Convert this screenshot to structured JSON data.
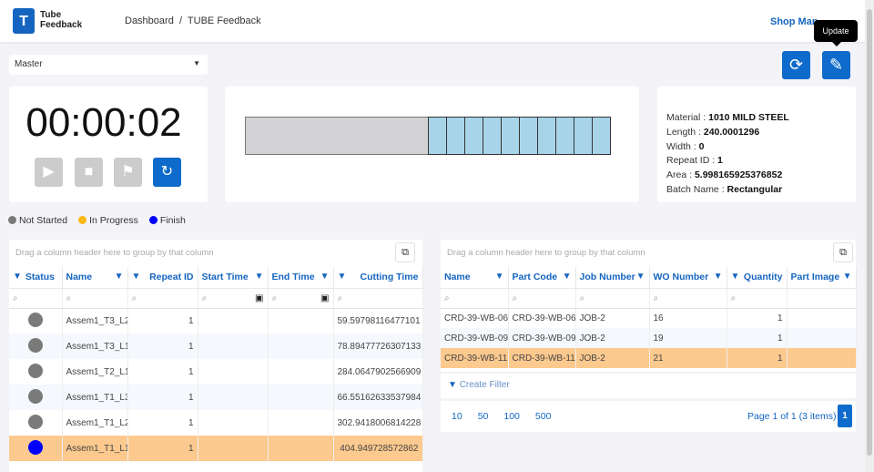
{
  "header": {
    "logo_line1": "Tube",
    "logo_line2": "Feedback",
    "breadcrumb": [
      "Dashboard",
      "TUBE Feedback"
    ],
    "user": "Shop Man"
  },
  "toolbar": {
    "select_value": "Master",
    "refresh_icon": "sync-icon",
    "update_icon": "edit-icon",
    "tooltip": "Update"
  },
  "timer": {
    "value": "00:00:02",
    "buttons": [
      "play-icon",
      "stop-icon",
      "flag-icon",
      "reset-icon"
    ]
  },
  "tube": {
    "total_segments": 10,
    "completed_color": "#d3d2d4",
    "segment_color": "#a8d4ea"
  },
  "info": [
    {
      "label": "Material : ",
      "value": "1010 MILD STEEL"
    },
    {
      "label": "Length : ",
      "value": "240.0001296"
    },
    {
      "label": "Width : ",
      "value": "0"
    },
    {
      "label": "Repeat ID : ",
      "value": "1"
    },
    {
      "label": "Area : ",
      "value": "5.998165925376852"
    },
    {
      "label": "Batch Name : ",
      "value": "Rectangular"
    }
  ],
  "legend": [
    {
      "label": "Not Started",
      "color": "#7a7a7a"
    },
    {
      "label": "In Progress",
      "color": "#fbb917"
    },
    {
      "label": "Finish",
      "color": "#0000ff"
    }
  ],
  "left_grid": {
    "group_hint": "Drag a column header here to group by that column",
    "columns": [
      "Status",
      "Name",
      "Repeat ID",
      "Start Time",
      "End Time",
      "Cutting Time"
    ],
    "rows": [
      {
        "status": "not-started",
        "name": "Assem1_T3_L2",
        "repeat_id": "1",
        "start": "",
        "end": "",
        "cutting": "59.59798116477101"
      },
      {
        "status": "not-started",
        "name": "Assem1_T3_L1",
        "repeat_id": "1",
        "start": "",
        "end": "",
        "cutting": "78.89477726307133"
      },
      {
        "status": "not-started",
        "name": "Assem1_T2_L1",
        "repeat_id": "1",
        "start": "",
        "end": "",
        "cutting": "284.0647902566909"
      },
      {
        "status": "not-started",
        "name": "Assem1_T1_L3",
        "repeat_id": "1",
        "start": "",
        "end": "",
        "cutting": "66.55162633537984"
      },
      {
        "status": "not-started",
        "name": "Assem1_T1_L2",
        "repeat_id": "1",
        "start": "",
        "end": "",
        "cutting": "302.9418006814228"
      },
      {
        "status": "finish",
        "name": "Assem1_T1_L1",
        "repeat_id": "1",
        "start": "",
        "end": "",
        "cutting": "404.949728572862"
      }
    ]
  },
  "right_grid": {
    "group_hint": "Drag a column header here to group by that column",
    "columns": [
      "Name",
      "Part Code",
      "Job Number",
      "WO Number",
      "Quantity",
      "Part Image"
    ],
    "rows": [
      {
        "name": "CRD-39-WB-06",
        "part_code": "CRD-39-WB-06",
        "job": "JOB-2",
        "wo": "16",
        "qty": "1"
      },
      {
        "name": "CRD-39-WB-09",
        "part_code": "CRD-39-WB-09",
        "job": "JOB-2",
        "wo": "19",
        "qty": "1"
      },
      {
        "name": "CRD-39-WB-11",
        "part_code": "CRD-39-WB-11",
        "job": "JOB-2",
        "wo": "21",
        "qty": "1"
      }
    ],
    "create_filter": "Create Filter",
    "page_sizes": [
      "10",
      "50",
      "100",
      "500"
    ],
    "page_info": "Page 1 of 1 (3 items)",
    "current_page": "1"
  }
}
